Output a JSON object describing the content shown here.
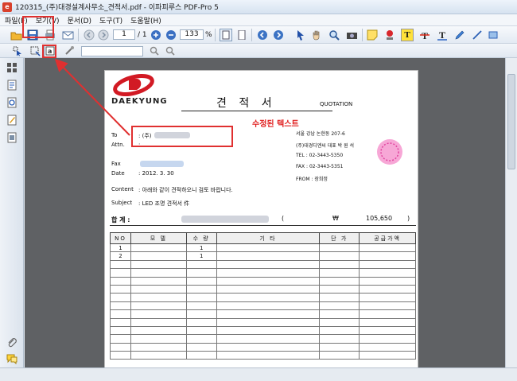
{
  "window": {
    "title": "120315_(주)대경설계사무소_견적서.pdf - 이파피루스 PDF-Pro 5"
  },
  "menu": [
    "파일(F)",
    "보기(V)",
    "문서(D)",
    "도구(T)",
    "도움말(H)"
  ],
  "toolbar": {
    "page_current": "1",
    "page_total": "/ 1",
    "zoom": "133",
    "zoom_unit": "%"
  },
  "document": {
    "logo": "DAEKYUNG",
    "title": "견 적 서",
    "title_en": "QUOTATION",
    "to_label": "To",
    "to_value": ": (주)",
    "attn_label": "Attn.",
    "attn_value": ":",
    "fax_label": "Fax",
    "date_label": "Date",
    "date_value": ": 2012. 3. 30",
    "content_label": "Content",
    "content_value": ": 아래와 같이 견적하오니 검토 바랍니다.",
    "subject_label": "Subject",
    "subject_value": ": LED 조명 견적서 件",
    "sender_address": "서울 강남 논현동 207-6",
    "sender_company": "(주)대경디엔씨    대표 박 원 석",
    "sender_tel": "TEL : 02-3443-5350",
    "sender_fax": "FAX : 02-3443-5351",
    "sender_from": "FROM : 장희정",
    "total_label": "합  계 :",
    "total_paren_open": "(",
    "total_currency": "₩",
    "total_amount": "105,650",
    "total_paren_close": ")",
    "table_headers": [
      "NO",
      "모 델",
      "수 량",
      "기 타",
      "단 가",
      "공급가액"
    ],
    "rows": [
      [
        "1",
        "",
        "1",
        "",
        "",
        ""
      ],
      [
        "2",
        "",
        "1",
        "",
        "",
        ""
      ]
    ]
  },
  "annotation": {
    "text": "수정된 텍스트",
    "color": "#e02020"
  }
}
